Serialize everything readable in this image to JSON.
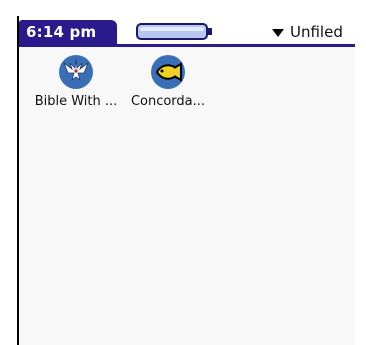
{
  "status_bar": {
    "time": "6:14 pm",
    "category": "Unfiled"
  },
  "apps": [
    {
      "label": "Bible With ...",
      "icon": "dove-icon"
    },
    {
      "label": "Concorda...",
      "icon": "fish-icon"
    }
  ],
  "colors": {
    "title_bar": "#2b1a8c",
    "screen_bg": "#f8f8f8",
    "battery_fill": "#b8c8f0"
  }
}
